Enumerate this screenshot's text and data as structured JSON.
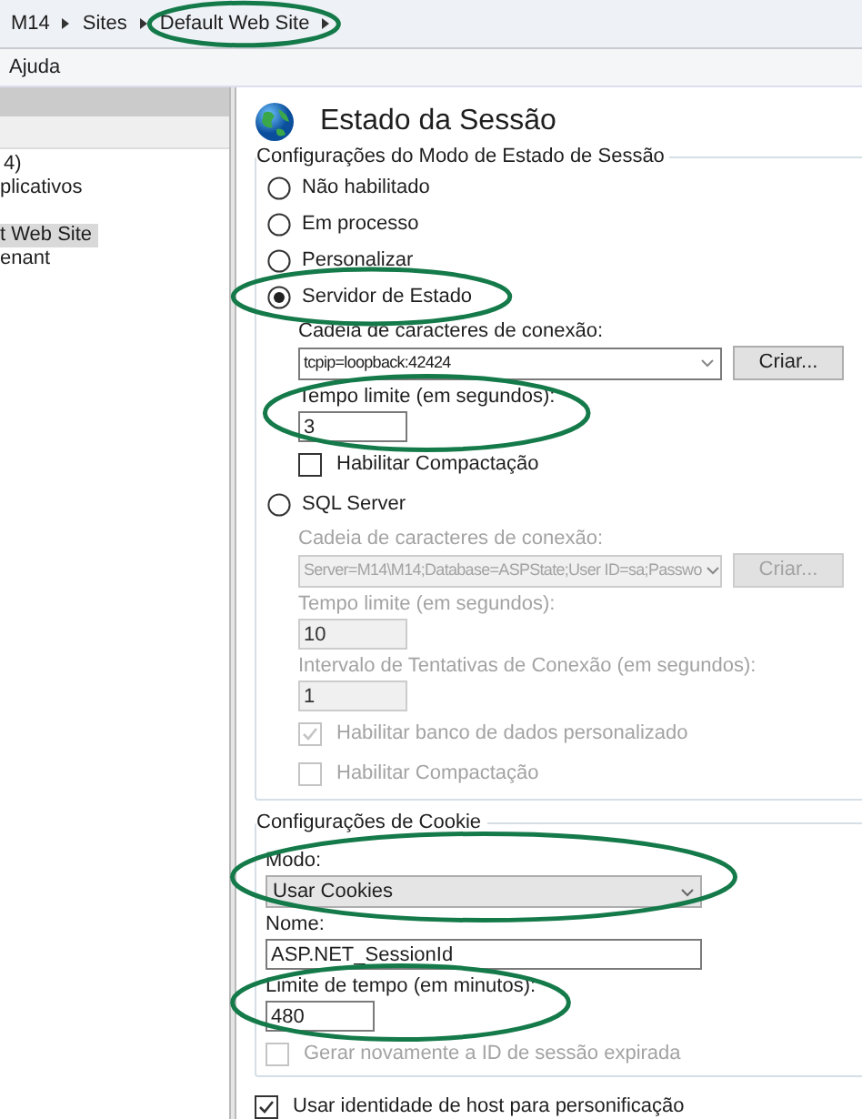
{
  "breadcrumb": [
    {
      "label": "M14"
    },
    {
      "label": "Sites"
    },
    {
      "label": "Default Web Site",
      "highlighted": true
    }
  ],
  "menu": [
    "Ajuda"
  ],
  "tree": [
    {
      "label": "4)",
      "selected": false
    },
    {
      "label": "plicativos",
      "selected": false
    },
    {
      "label": "t Web Site",
      "selected": true
    },
    {
      "label": "enant",
      "selected": false
    }
  ],
  "panel": {
    "title": "Estado da Sessão",
    "mode_group": {
      "title": "Configurações do Modo de Estado de Sessão",
      "options": [
        {
          "label": "Não habilitado",
          "selected": false
        },
        {
          "label": "Em processo",
          "selected": false
        },
        {
          "label": "Personalizar",
          "selected": false
        },
        {
          "label": "Servidor de Estado",
          "selected": true,
          "highlighted": true,
          "fields": [
            {
              "kind": "combo",
              "label": "Cadeia de caracteres de conexão:",
              "value": "tcpip=loopback:42424",
              "button": "Criar...",
              "disabled": false
            },
            {
              "kind": "number",
              "label": "Tempo limite (em segundos):",
              "value": "3",
              "disabled": false,
              "highlighted": true
            },
            {
              "kind": "checkbox",
              "label": "Habilitar Compactação",
              "checked": false,
              "disabled": false
            }
          ]
        },
        {
          "label": "SQL Server",
          "selected": false,
          "fields": [
            {
              "kind": "combo",
              "label": "Cadeia de caracteres de conexão:",
              "value": "Server=M14\\M14;Database=ASPState;User ID=sa;Passwo",
              "button": "Criar...",
              "disabled": true
            },
            {
              "kind": "number",
              "label": "Tempo limite (em segundos):",
              "value": "10",
              "disabled": true
            },
            {
              "kind": "number",
              "label": "Intervalo de Tentativas de Conexão (em segundos):",
              "value": "1",
              "disabled": true
            },
            {
              "kind": "checkbox",
              "label": "Habilitar banco de dados personalizado",
              "checked": true,
              "disabled": true
            },
            {
              "kind": "checkbox",
              "label": "Habilitar Compactação",
              "checked": false,
              "disabled": true
            }
          ]
        }
      ]
    },
    "cookie_group": {
      "title": "Configurações de Cookie",
      "fields": [
        {
          "kind": "select",
          "label": "Modo:",
          "value": "Usar Cookies",
          "disabled": false,
          "highlighted": true
        },
        {
          "kind": "text",
          "label": "Nome:",
          "value": "ASP.NET_SessionId",
          "disabled": false
        },
        {
          "kind": "number",
          "label": "Limite de tempo (em minutos):",
          "value": "480",
          "disabled": false,
          "highlighted": true
        },
        {
          "kind": "checkbox",
          "label": "Gerar novamente a ID de sessão expirada",
          "checked": false,
          "disabled": true
        }
      ]
    },
    "host_identity": {
      "label": "Usar identidade de host para personificação",
      "checked": true
    }
  }
}
